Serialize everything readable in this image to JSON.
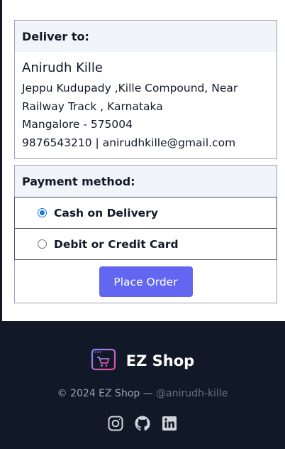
{
  "delivery": {
    "heading": "Deliver to:",
    "name": "Anirudh Kille",
    "address_line1": "Jeppu Kudupady ,Kille Compound, Near",
    "address_line2": "Railway Track , Karnataka",
    "city_line": "Mangalore - 575004",
    "contact_line": "9876543210 | anirudhkille@gmail.com"
  },
  "payment": {
    "heading": "Payment method:",
    "options": [
      {
        "label": "Cash on Delivery",
        "selected": true
      },
      {
        "label": "Debit or Credit Card",
        "selected": false
      }
    ],
    "place_order_label": "Place Order"
  },
  "footer": {
    "brand": "EZ Shop",
    "copyright": "© 2024 EZ Shop —",
    "handle": "@anirudh-kille",
    "socials": [
      "instagram-icon",
      "github-icon",
      "linkedin-icon"
    ]
  },
  "colors": {
    "accent": "#6366f1",
    "footer_bg": "#111827",
    "card_header_bg": "#f1f5f9",
    "radio_selected": "#1a73e8"
  }
}
